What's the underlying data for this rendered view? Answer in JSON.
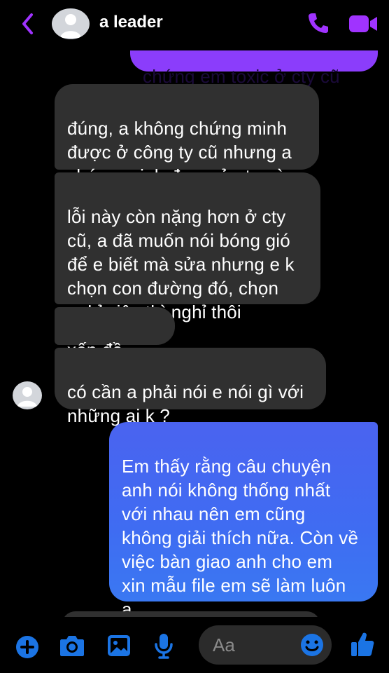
{
  "header": {
    "contact_name": "a leader",
    "back_icon": "chevron-left-icon",
    "call_icon": "phone-icon",
    "video_icon": "video-camera-icon",
    "accent_color": "#a033ff"
  },
  "messages": [
    {
      "id": "m0",
      "direction": "outgoing",
      "text": "chứng em toxic ở cty cũ",
      "color": "#8b3dfb"
    },
    {
      "id": "m1",
      "direction": "incoming",
      "text": "đúng, a không chứng minh\nđược ở công ty cũ nhưng a\nchứng minh được ở cty này"
    },
    {
      "id": "m2",
      "direction": "incoming",
      "text": "lỗi này còn nặng hơn ở cty\ncũ, a đã muốn nói bóng gió\nđể e biết mà sửa nhưng e k\nchọn con đường đó, chọn\nnghỉ việc thì nghỉ thôi"
    },
    {
      "id": "m3",
      "direction": "incoming",
      "text": "xếp đồ chưa"
    },
    {
      "id": "m4",
      "direction": "incoming",
      "text": "có cần a phải nói e nói gì với\nnhững ai k ?"
    },
    {
      "id": "m5",
      "direction": "outgoing",
      "text": "Em thấy rằng câu chuyện\nanh nói không thống nhất\nvới nhau nên em cũng\nkhông giải thích nữa. Còn về\nviệc bàn giao anh cho em\nxin mẫu file em sẽ làm luôn\nạ",
      "color": "#3f6cf2"
    }
  ],
  "composer": {
    "placeholder": "Aa",
    "icons": [
      "plus-circle-icon",
      "camera-icon",
      "image-icon",
      "microphone-icon",
      "emoji-icon",
      "thumbs-up-icon"
    ]
  }
}
